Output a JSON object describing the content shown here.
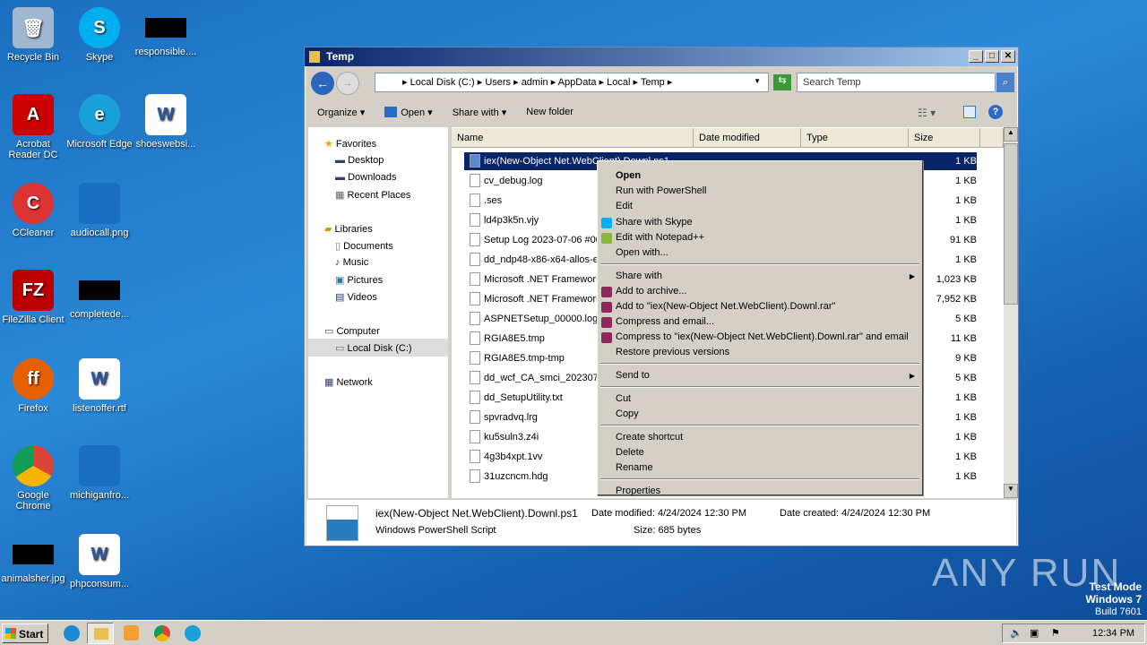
{
  "desktop": {
    "icons": [
      {
        "label": "Recycle Bin"
      },
      {
        "label": "Skype"
      },
      {
        "label": "responsible...."
      },
      {
        "label": "Acrobat Reader DC"
      },
      {
        "label": "Microsoft Edge"
      },
      {
        "label": "shoeswebsi..."
      },
      {
        "label": "CCleaner"
      },
      {
        "label": "audiocall.png"
      },
      {
        "label": "FileZilla Client"
      },
      {
        "label": "completede..."
      },
      {
        "label": "Firefox"
      },
      {
        "label": "listenoffer.rtf"
      },
      {
        "label": "Google Chrome"
      },
      {
        "label": "michiganfro..."
      },
      {
        "label": "animalsher.jpg"
      },
      {
        "label": "phpconsum..."
      }
    ]
  },
  "window": {
    "title": "Temp",
    "address": "▸ Local Disk (C:) ▸ Users ▸ admin ▸ AppData ▸ Local ▸ Temp ▸",
    "search_placeholder": "Search Temp",
    "toolbar": {
      "organize": "Organize ▾",
      "open": "Open ▾",
      "share": "Share with ▾",
      "new_folder": "New folder"
    },
    "nav": [
      "Favorites",
      "Desktop",
      "Downloads",
      "Recent Places",
      "Libraries",
      "Documents",
      "Music",
      "Pictures",
      "Videos",
      "Computer",
      "Local Disk (C:)",
      "Network"
    ],
    "columns": {
      "name": "Name",
      "date": "Date modified",
      "type": "Type",
      "size": "Size"
    },
    "files": [
      {
        "name": "iex(New-Object Net.WebClient).Downl.ps1",
        "size": "1 KB"
      },
      {
        "name": "cv_debug.log",
        "size": "1 KB"
      },
      {
        "name": ".ses",
        "size": "1 KB"
      },
      {
        "name": "ld4p3k5n.vjy",
        "size": "1 KB"
      },
      {
        "name": "Setup Log 2023-07-06 #001.txt",
        "size": "91 KB"
      },
      {
        "name": "dd_ndp48-x86-x64-allos-enu.log",
        "size": "1 KB"
      },
      {
        "name": "Microsoft .NET Framework 4.8 Setup.html",
        "size": "1,023 KB"
      },
      {
        "name": "Microsoft .NET Framework 4.8 Setup.txt",
        "size": "7,952 KB"
      },
      {
        "name": "ASPNETSetup_00000.log",
        "size": "5 KB"
      },
      {
        "name": "RGIA8E5.tmp",
        "size": "11 KB"
      },
      {
        "name": "RGIA8E5.tmp-tmp",
        "size": "9 KB"
      },
      {
        "name": "dd_wcf_CA_smci_20230706.txt",
        "size": "5 KB"
      },
      {
        "name": "dd_SetupUtility.txt",
        "size": "1 KB"
      },
      {
        "name": "spvradvq.lrg",
        "size": "1 KB"
      },
      {
        "name": "ku5suln3.z4i",
        "size": "1 KB"
      },
      {
        "name": "4g3b4xpt.1vv",
        "size": "1 KB"
      },
      {
        "name": "31uzcncm.hdg",
        "size": "1 KB"
      }
    ],
    "details": {
      "filename": "iex(New-Object Net.WebClient).Downl.ps1",
      "type": "Windows PowerShell Script",
      "modified": "Date modified: 4/24/2024 12:30 PM",
      "created": "Date created: 4/24/2024 12:30 PM",
      "size": "Size: 685 bytes"
    }
  },
  "context_menu": {
    "items": [
      "Open",
      "Run with PowerShell",
      "Edit",
      "Share with Skype",
      "Edit with Notepad++",
      "Open with...",
      "Share with",
      "Add to archive...",
      "Add to \"iex(New-Object Net.WebClient).Downl.rar\"",
      "Compress and email...",
      "Compress to \"iex(New-Object Net.WebClient).Downl.rar\" and email",
      "Restore previous versions",
      "Send to",
      "Cut",
      "Copy",
      "Create shortcut",
      "Delete",
      "Rename",
      "Properties"
    ]
  },
  "taskbar": {
    "start": "Start",
    "clock": "12:34 PM"
  },
  "watermark": {
    "brand": "ANY RUN",
    "mode": "Test Mode",
    "os": "Windows 7",
    "build": "Build 7601"
  }
}
